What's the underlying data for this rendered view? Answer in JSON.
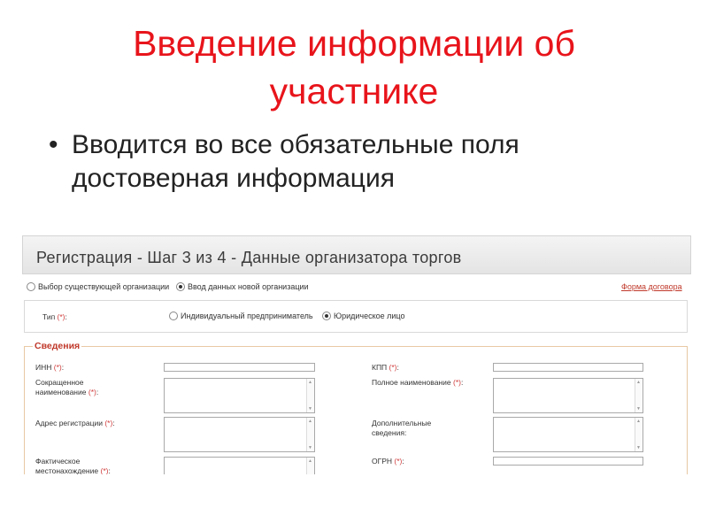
{
  "slide": {
    "title_line1": "Введение информации об",
    "title_line2": "участнике",
    "bullet_symbol": "•",
    "bullet_text": "Вводится во все обязательные поля достоверная информация"
  },
  "form": {
    "header_title": "Регистрация - Шаг 3 из 4 - Данные организатора торгов",
    "org_options": [
      {
        "label": "Выбор существующей организации",
        "selected": false
      },
      {
        "label": "Ввод данных новой организации",
        "selected": true
      }
    ],
    "contract_link": "Форма договора",
    "type": {
      "label": "Тип",
      "required_mark": "(*)",
      "suffix": ":",
      "options": [
        {
          "label": "Индивидуальный предприниматель",
          "selected": false
        },
        {
          "label": "Юридическое лицо",
          "selected": true
        }
      ]
    },
    "section_title": "Сведения",
    "left_fields": [
      {
        "label": "ИНН",
        "req": "(*)",
        "suffix": ":"
      },
      {
        "label": "Сокращенное наименование",
        "req": "(*)",
        "suffix": ":"
      },
      {
        "label": "Адрес регистрации",
        "req": "(*)",
        "suffix": ":"
      },
      {
        "label": "Фактическое местонахождение",
        "req": "(*)",
        "suffix": ":"
      }
    ],
    "right_fields": [
      {
        "label": "КПП",
        "req": "(*)",
        "suffix": ":"
      },
      {
        "label": "Полное наименование",
        "req": "(*)",
        "suffix": ":"
      },
      {
        "label": "Дополнительные сведения:",
        "req": "",
        "suffix": ""
      },
      {
        "label": "ОГРН",
        "req": "(*)",
        "suffix": ":"
      }
    ],
    "colors": {
      "accent_red": "#e8141b",
      "required": "#d13b3b"
    }
  }
}
